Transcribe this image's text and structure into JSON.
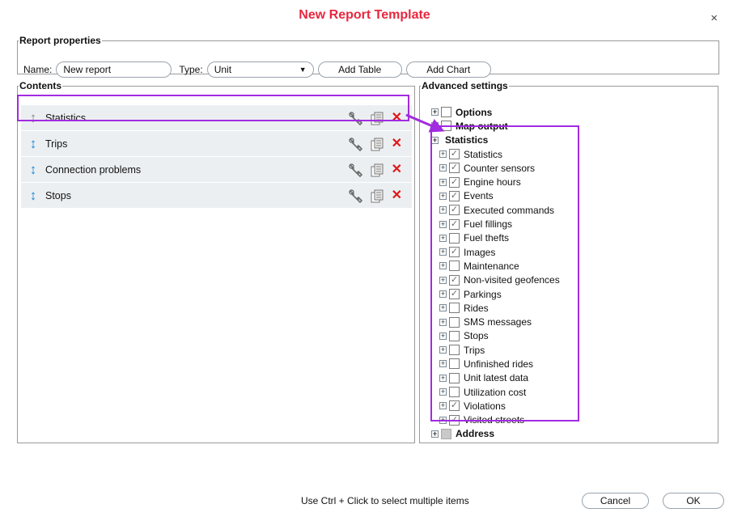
{
  "dialog": {
    "title": "New Report Template",
    "close_glyph": "×"
  },
  "properties": {
    "legend": "Report properties",
    "name_label": "Name:",
    "name_value": "New report",
    "type_label": "Type:",
    "type_value": "Unit",
    "add_table_label": "Add Table",
    "add_chart_label": "Add Chart"
  },
  "contents": {
    "legend": "Contents",
    "rows": [
      {
        "name": "Statistics",
        "icon": "drag-arrow-icon"
      },
      {
        "name": "Trips",
        "icon": "drag-arrow-icon"
      },
      {
        "name": "Connection problems",
        "icon": "drag-arrow-icon"
      },
      {
        "name": "Stops",
        "icon": "drag-arrow-icon"
      }
    ]
  },
  "advanced": {
    "legend": "Advanced settings",
    "top_nodes": [
      {
        "label": "Options",
        "checked": false
      },
      {
        "label": "Map output",
        "checked": false
      }
    ],
    "statistics_node": {
      "label": "Statistics"
    },
    "statistics_children": [
      {
        "label": "Statistics",
        "checked": true
      },
      {
        "label": "Counter sensors",
        "checked": true
      },
      {
        "label": "Engine hours",
        "checked": true
      },
      {
        "label": "Events",
        "checked": true
      },
      {
        "label": "Executed commands",
        "checked": true
      },
      {
        "label": "Fuel fillings",
        "checked": true
      },
      {
        "label": "Fuel thefts",
        "checked": false
      },
      {
        "label": "Images",
        "checked": true
      },
      {
        "label": "Maintenance",
        "checked": false
      },
      {
        "label": "Non-visited geofences",
        "checked": true
      },
      {
        "label": "Parkings",
        "checked": true
      },
      {
        "label": "Rides",
        "checked": false
      },
      {
        "label": "SMS messages",
        "checked": false
      },
      {
        "label": "Stops",
        "checked": false
      },
      {
        "label": "Trips",
        "checked": false
      },
      {
        "label": "Unfinished rides",
        "checked": false
      },
      {
        "label": "Unit latest data",
        "checked": false
      },
      {
        "label": "Utilization cost",
        "checked": false
      },
      {
        "label": "Violations",
        "checked": true
      },
      {
        "label": "Visited streets",
        "checked": true
      }
    ],
    "address_node": {
      "label": "Address"
    }
  },
  "footer": {
    "hint": "Use Ctrl + Click to select multiple items",
    "cancel_label": "Cancel",
    "ok_label": "OK"
  },
  "colors": {
    "title": "#e8273e",
    "highlight": "#a12be0",
    "delete": "#e01818",
    "drag_arrow": "#1e88d7"
  }
}
